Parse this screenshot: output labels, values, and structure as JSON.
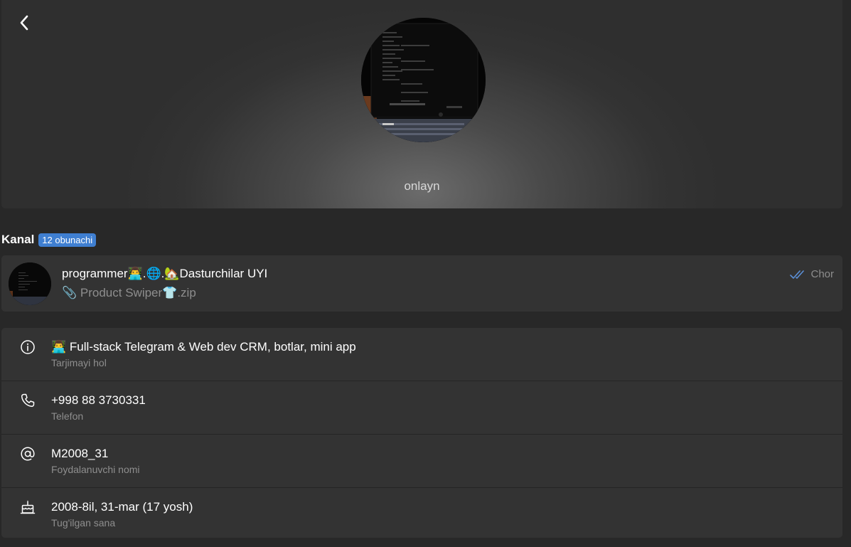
{
  "profile": {
    "status": "onlayn"
  },
  "channel_section": {
    "title": "Kanal",
    "badge": "12 obunachi",
    "card": {
      "name": "programmer👨‍💻.🌐.🏡Dasturchilar UYI",
      "last_message": "📎 Product Swiper👕.zip",
      "time": "Chor"
    }
  },
  "info": {
    "bio": {
      "value": "👨‍💻 Full-stack Telegram & Web dev CRM, botlar, mini app",
      "label": "Tarjimayi hol"
    },
    "phone": {
      "value": "+998 88 3730331",
      "label": "Telefon"
    },
    "username": {
      "value": "M2008_31",
      "label": "Foydalanuvchi nomi"
    },
    "birthday": {
      "value": "2008-8il, 31-mar (17 yosh)",
      "label": "Tug'ilgan sana"
    }
  },
  "icons": {
    "back": "chevron-left-icon",
    "bio": "info-icon",
    "phone": "phone-icon",
    "username": "at-sign-icon",
    "birthday": "cake-icon",
    "read": "double-check-icon"
  },
  "colors": {
    "background": "#282828",
    "card": "#333333",
    "badge": "#3f7fd1",
    "read_check": "#5b8fd6",
    "secondary_text": "#8e8e8e"
  }
}
